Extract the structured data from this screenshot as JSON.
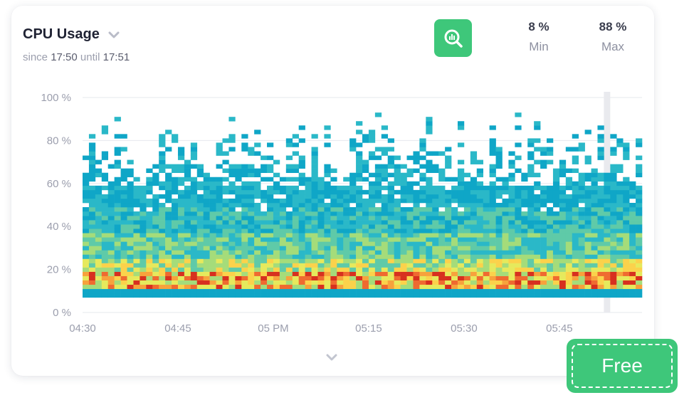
{
  "header": {
    "title": "CPU Usage",
    "since_label": "since",
    "since_time": "17:50",
    "until_label": "until",
    "until_time": "17:51"
  },
  "stats": {
    "min_value": "8 %",
    "min_label": "Min",
    "max_value": "88 %",
    "max_label": "Max"
  },
  "badge": {
    "label": "Free"
  },
  "icons": {
    "title_dropdown": "chevron-down-icon",
    "zoom": "zoom-chart-icon",
    "expand": "chevron-down-icon"
  },
  "colors": {
    "accent": "#3ec77a",
    "grid": "#e6e8ee",
    "scale": [
      "#0fa6c7",
      "#2ab8c8",
      "#5fcaa8",
      "#a5dc7a",
      "#e6e95c",
      "#fbd24b",
      "#f7a23c",
      "#ef6a30",
      "#d7301f"
    ]
  },
  "chart_data": {
    "type": "heatmap",
    "title": "CPU Usage",
    "xlabel": "",
    "ylabel": "",
    "x_ticks": [
      "04:30",
      "04:45",
      "05 PM",
      "05:15",
      "05:30",
      "05:45"
    ],
    "y_ticks": [
      "0 %",
      "20 %",
      "40 %",
      "60 %",
      "80 %",
      "100 %"
    ],
    "ylim": [
      0,
      100
    ],
    "x_range": [
      "04:30",
      "05:58"
    ],
    "bucket_size_percent": 2,
    "column_count": 88,
    "row_min_percent": 7,
    "row_max_percent": 92,
    "min_percent": 8,
    "max_percent": 88,
    "highlight_time": "05:52",
    "grid": true,
    "legend": "none",
    "description_density": "peak density around 12-17 %, sparse above 60 %"
  }
}
